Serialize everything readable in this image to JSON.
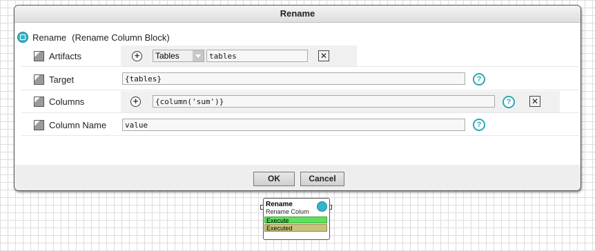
{
  "dialog": {
    "title": "Rename",
    "block": {
      "name": "Rename",
      "subtitle": "(Rename Column Block)",
      "icon": "block-icon"
    },
    "properties": [
      {
        "label": "Artifacts",
        "select_value": "Tables",
        "field_value": "tables",
        "icons": [
          "add-icon",
          "remove-icon"
        ]
      },
      {
        "label": "Target",
        "field_value": "{tables}",
        "icons": [
          "help-icon"
        ]
      },
      {
        "label": "Columns",
        "field_value": "{column('sum')}",
        "icons": [
          "add-icon",
          "help-icon",
          "remove-icon"
        ]
      },
      {
        "label": "Column Name",
        "field_value": "value",
        "icons": [
          "help-icon"
        ]
      }
    ],
    "buttons": {
      "ok": "OK",
      "cancel": "Cancel"
    }
  },
  "node": {
    "title": "Rename",
    "subtitle": "Rename Colum",
    "ports": {
      "execute": "Execute",
      "executed": "Executed"
    },
    "colors": {
      "execute": "#5fe05f",
      "executed": "#c9c27a"
    }
  },
  "glyphs": {
    "help": "?",
    "add": "+",
    "remove": "✕"
  }
}
